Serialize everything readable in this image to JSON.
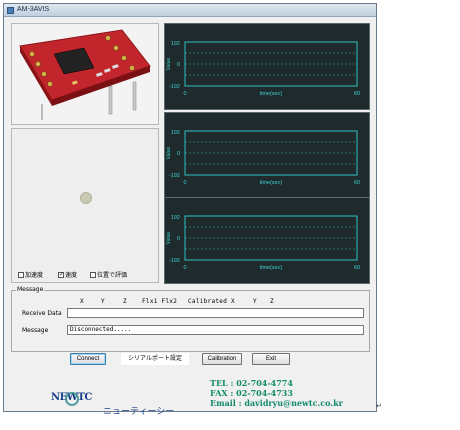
{
  "window": {
    "title": "AM-3AVIS"
  },
  "charts": [
    {
      "y_top": "192",
      "y_mid": "0",
      "y_bottom": "-192",
      "axis_label": "Value",
      "x_start": "0",
      "x_label": "time(sec)",
      "x_end": "60"
    },
    {
      "y_top": "192",
      "y_mid": "0",
      "y_bottom": "-192",
      "axis_label": "Value",
      "x_start": "0",
      "x_label": "time(sec)",
      "x_end": "60"
    },
    {
      "y_top": "192",
      "y_mid": "0",
      "y_bottom": "-192",
      "axis_label": "Value",
      "x_start": "0",
      "x_label": "time(sec)",
      "x_end": "60"
    }
  ],
  "checkboxes": [
    {
      "label": "加速度",
      "checked": false
    },
    {
      "label": "速度",
      "checked": true
    },
    {
      "label": "位置で評価",
      "checked": false
    }
  ],
  "message": {
    "group_label": "Message",
    "columns": [
      "X",
      "Y",
      "Z",
      "Flx1 Flx2",
      "Calibrated X",
      "Y",
      "Z"
    ],
    "receive_label": "Receive Data",
    "receive_value": "",
    "message_label": "Message",
    "message_value": "Disconnected....."
  },
  "buttons": {
    "connect": "Connect",
    "serial": "シリアルポート設定",
    "calibration": "Calibration",
    "exit": "Exit"
  },
  "footer": {
    "logo": "NEWTC",
    "company": "ニューティーシー",
    "tel": "TEL : 02-704-4774",
    "fax": "FAX : 02-704-4733",
    "email": "Email : davidryu@newtc.co.kr"
  },
  "colors": {
    "chart_bg": "#1e2a2c",
    "chart_line": "#2fc3c3",
    "chart_text": "#3fd3d3",
    "contact_text": "#128a6a",
    "company_text": "#1a3e8a"
  }
}
